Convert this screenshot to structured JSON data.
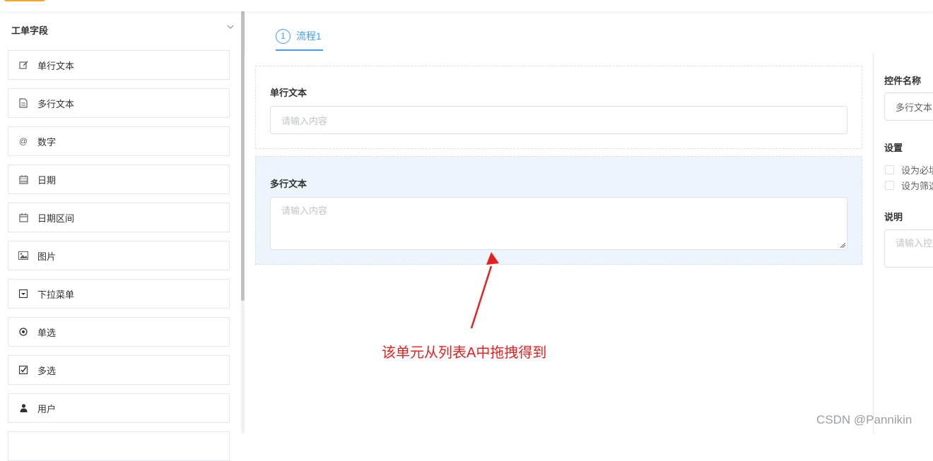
{
  "sidebar": {
    "title": "工单字段",
    "items": [
      {
        "label": "单行文本",
        "icon": "edit-icon"
      },
      {
        "label": "多行文本",
        "icon": "document-icon"
      },
      {
        "label": "数字",
        "icon": "at-icon"
      },
      {
        "label": "日期",
        "icon": "calendar-icon"
      },
      {
        "label": "日期区间",
        "icon": "calendar-range-icon"
      },
      {
        "label": "图片",
        "icon": "image-icon"
      },
      {
        "label": "下拉菜单",
        "icon": "dropdown-icon"
      },
      {
        "label": "单选",
        "icon": "radio-icon"
      },
      {
        "label": "多选",
        "icon": "checkbox-icon"
      },
      {
        "label": "用户",
        "icon": "user-icon"
      }
    ]
  },
  "tabs": [
    {
      "number": "1",
      "label": "流程1"
    }
  ],
  "form": {
    "items": [
      {
        "label": "单行文本",
        "placeholder": "请输入内容",
        "type": "input"
      },
      {
        "label": "多行文本",
        "placeholder": "请输入内容",
        "type": "textarea"
      }
    ]
  },
  "annotation": {
    "text": "该单元从列表A中拖拽得到",
    "color": "#e3221f"
  },
  "properties": {
    "name_title": "控件名称",
    "name_value": "多行文本",
    "settings_title": "设置",
    "checkboxes": [
      "设为必填",
      "设为筛选"
    ],
    "desc_title": "说明",
    "desc_placeholder": "请输入控件说明"
  },
  "watermark": "CSDN @Pannikin",
  "colors": {
    "accent": "#409eff",
    "active_item_bg": "#ecf5fc",
    "border": "#dcdfe6"
  }
}
